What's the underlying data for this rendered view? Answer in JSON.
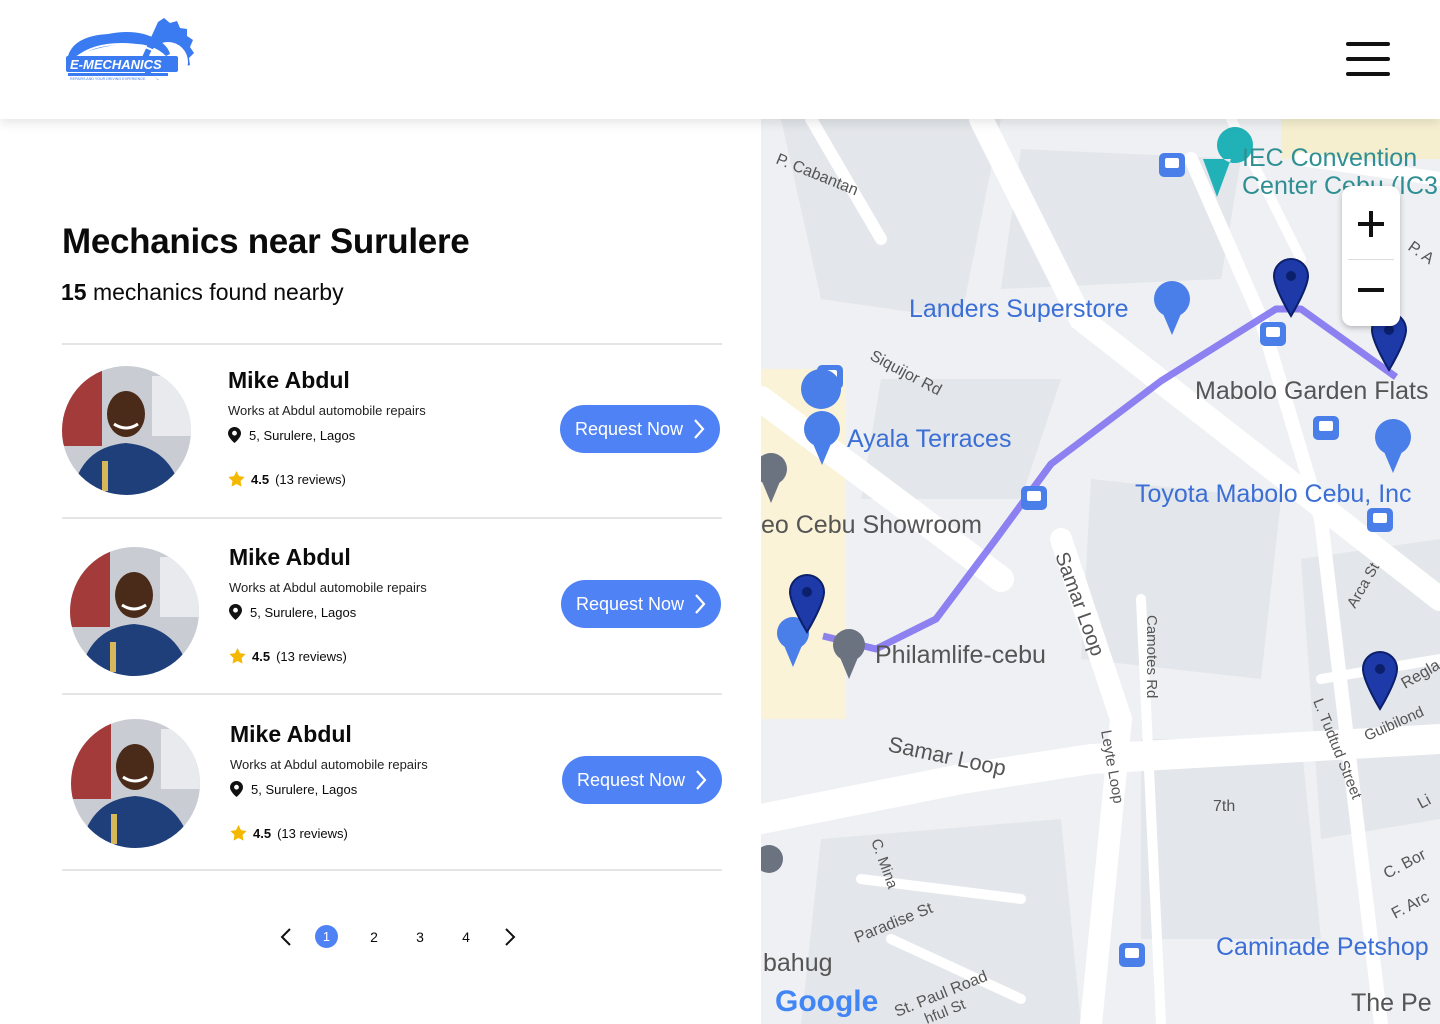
{
  "brand": {
    "logo_text": "E-MECHANICS",
    "logo_tagline": "REPAIRS AND YOUR DRIVING EXPERIENCE"
  },
  "header": {
    "menu_icon": "hamburger-menu-icon"
  },
  "listing": {
    "title": "Mechanics near Surulere",
    "count": "15",
    "count_suffix": " mechanics found nearby"
  },
  "mechanics": [
    {
      "name": "Mike Abdul",
      "works": "Works at Abdul automobile repairs",
      "location": "5, Surulere, Lagos",
      "rating": "4.5",
      "reviews": "(13 reviews)",
      "button": "Request Now"
    },
    {
      "name": "Mike Abdul",
      "works": "Works at Abdul automobile repairs",
      "location": "5, Surulere, Lagos",
      "rating": "4.5",
      "reviews": "(13 reviews)",
      "button": "Request Now"
    },
    {
      "name": "Mike Abdul",
      "works": "Works at Abdul automobile repairs",
      "location": "5, Surulere, Lagos",
      "rating": "4.5",
      "reviews": "(13 reviews)",
      "button": "Request Now"
    }
  ],
  "pagination": {
    "pages": [
      "1",
      "2",
      "3",
      "4"
    ],
    "current": "1"
  },
  "map": {
    "zoom_in": "+",
    "zoom_out": "−",
    "provider": "Google",
    "labels": {
      "iec": "IEC Convention",
      "iec2": "Center Cebu (IC3",
      "cabantan": "P. Cabantan",
      "landers": "Landers Superstore",
      "mabolo": "Mabolo Garden Flats",
      "siquijor": "Siquijor Rd",
      "ayala": "Ayala Terraces",
      "toyota": "Toyota Mabolo Cebu, Inc",
      "showroom": "eo Cebu Showroom",
      "samar": "Samar Loop",
      "samar_loop": "Samar Loop",
      "philam": "Philamlife-cebu",
      "camotes": "Camotes Rd",
      "leyte": "Leyte Loop",
      "tudtud": "L. Tudtud Street",
      "arca": "Arca St",
      "regla": "Regla",
      "guibilond": "Guibilond",
      "seventh": "7th",
      "mina": "C. Mina",
      "paradise": "Paradise St",
      "bahug": "bahug",
      "stpaul": "St. Paul Road",
      "hful": "hful St",
      "caminade": "Caminade Petshop",
      "thepe": "The Pe",
      "cbor": "C. Bor",
      "farc": "F. Arc",
      "li": "Li",
      "pa": "P. A"
    },
    "colors": {
      "route": "#7b6cf0",
      "pin": "#1e3aa8",
      "accent": "#4f82f5"
    }
  }
}
